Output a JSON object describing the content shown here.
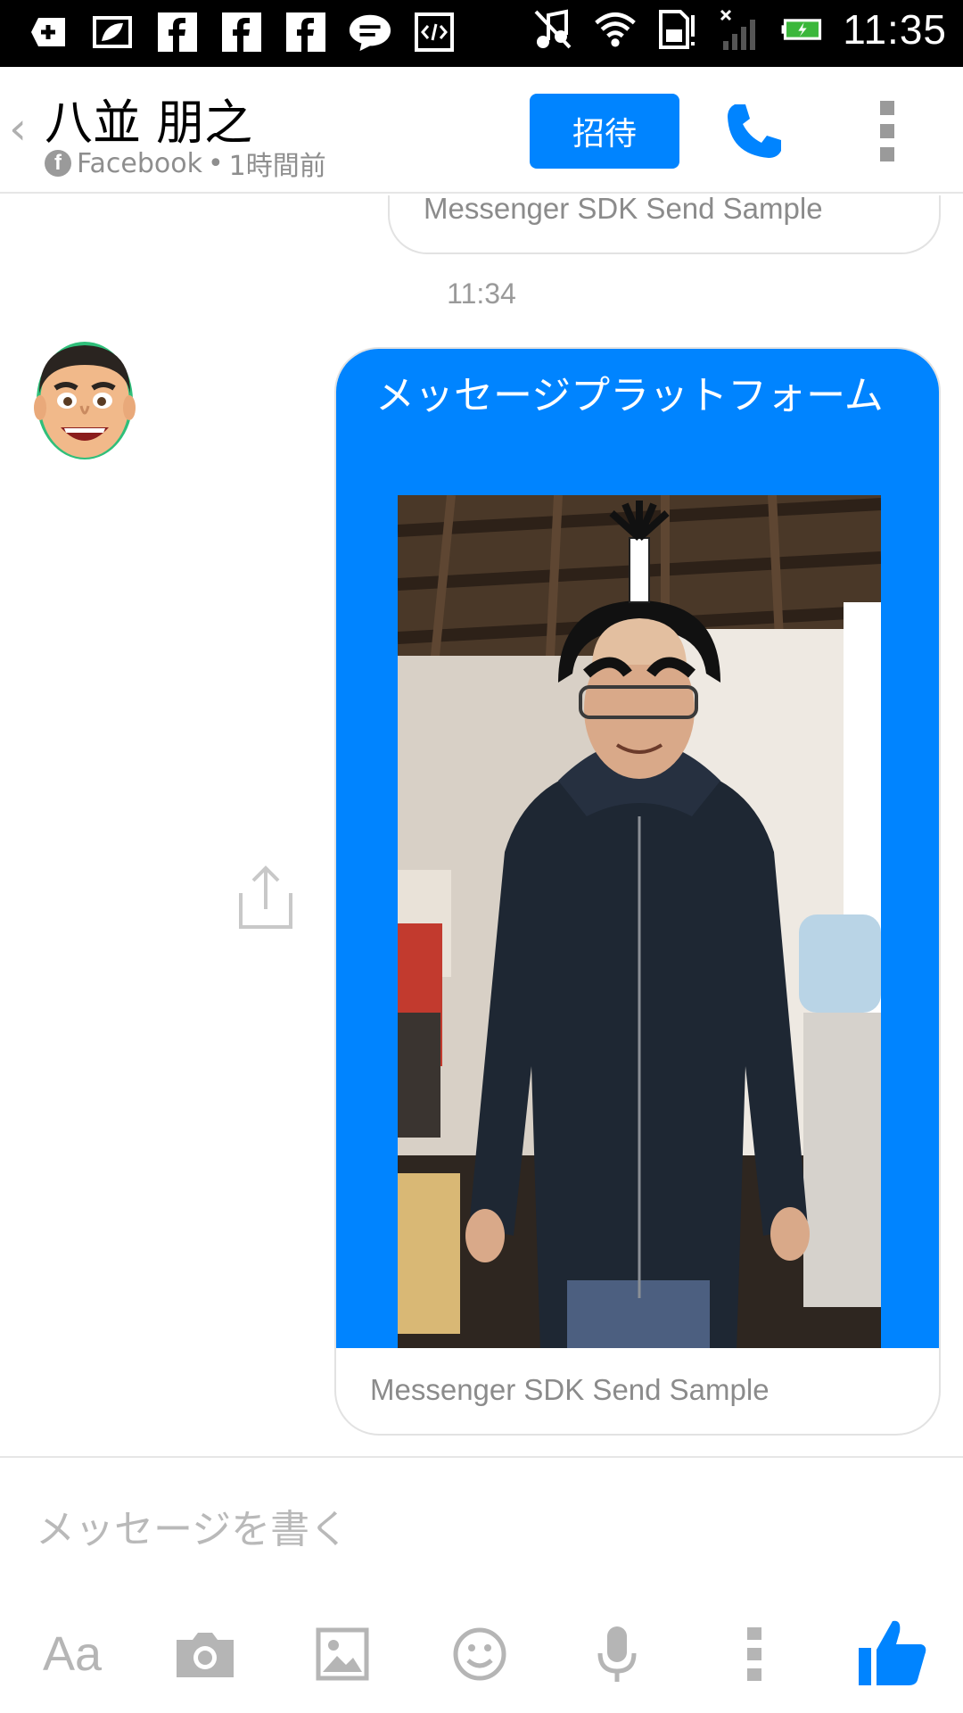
{
  "status_bar": {
    "time": "11:35"
  },
  "header": {
    "back_icon": "chevron-left-icon",
    "contact_name": "八並 朋之",
    "source": "Facebook",
    "separator": "•",
    "last_active": "1時間前",
    "invite_label": "招待",
    "call_icon": "phone-icon",
    "menu_icon": "more-vertical-icon"
  },
  "conversation": {
    "previous_card_caption": "Messenger SDK Send Sample",
    "timestamp": "11:34",
    "message": {
      "text": "メッセージプラットフォーム",
      "caption": "Messenger SDK Send Sample"
    }
  },
  "composer": {
    "placeholder": "メッセージを書く",
    "text_format_label": "Aa"
  },
  "colors": {
    "accent": "#0084ff",
    "muted": "#b5b5b5"
  }
}
